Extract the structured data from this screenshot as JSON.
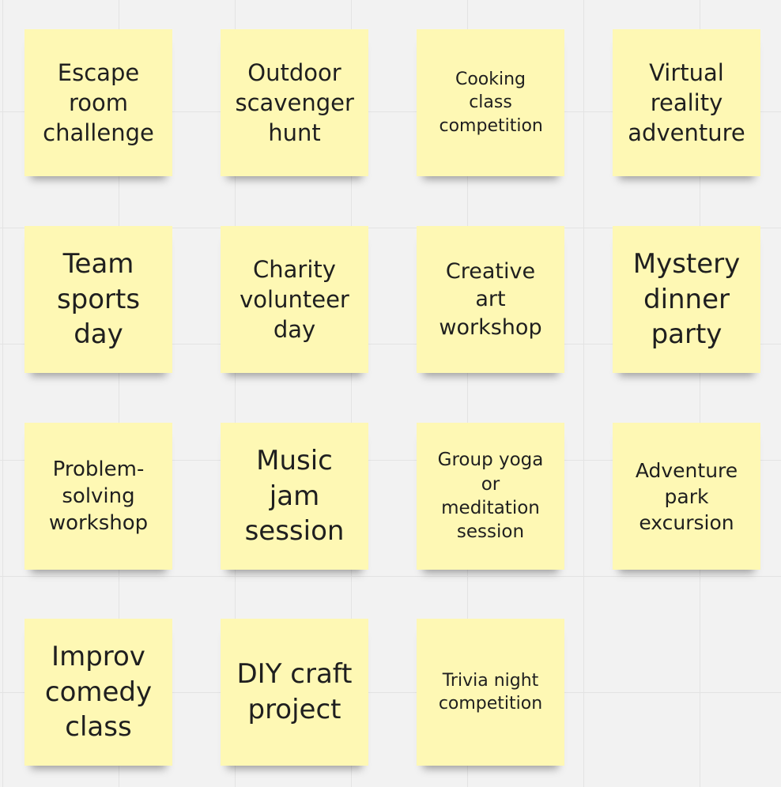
{
  "board": {
    "sticky_color": "#fef8b4",
    "notes": [
      {
        "text": "Escape room challenge"
      },
      {
        "text": "Outdoor scavenger hunt"
      },
      {
        "text": "Cooking class competition"
      },
      {
        "text": "Virtual reality adventure"
      },
      {
        "text": "Team sports day"
      },
      {
        "text": "Charity volunteer day"
      },
      {
        "text": "Creative art workshop"
      },
      {
        "text": "Mystery dinner party"
      },
      {
        "text": "Problem-solving workshop"
      },
      {
        "text": "Music jam session"
      },
      {
        "text": "Group yoga or meditation session"
      },
      {
        "text": "Adventure park excursion"
      },
      {
        "text": "Improv comedy class"
      },
      {
        "text": "DIY craft project"
      },
      {
        "text": "Trivia night competition"
      }
    ]
  }
}
